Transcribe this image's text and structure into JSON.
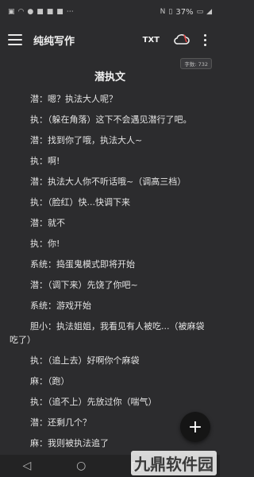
{
  "status_bar": {
    "battery_text": "37%",
    "left_icons": [
      "sim-icon",
      "wifi-icon",
      "app-icon",
      "app-icon",
      "app-icon",
      "app-icon",
      "more-icon"
    ],
    "right_icons": [
      "nfc-icon",
      "vibrate-icon",
      "battery-icon",
      "signal-icon"
    ]
  },
  "app_bar": {
    "title": "纯纯写作",
    "txt_label": "TXT"
  },
  "word_count": "字数: 732",
  "document": {
    "title": "潜执文",
    "paragraphs": [
      "潜：嗯？执法大人呢？",
      "执：（躲在角落）这下不会遇见潜行了吧。",
      "潜：找到你了哦，执法大人~",
      "执：啊!",
      "潜：执法大人你不听话哦~（调高三档）",
      "执：（脸红）快...快调下来",
      "潜：就不",
      "执：你!",
      "系统：捣蛋鬼模式即将开始",
      "潜：（调下来）先饶了你吧~",
      "系统：游戏开始",
      "胆小：执法姐姐，我看见有人被吃...（被麻袋吃了）",
      "执：（追上去）好啊你个麻袋",
      "麻：（跑）",
      "执：（追不上）先放过你（喘气）",
      "潜：还剩几个？",
      "麻：我则被执法追了"
    ]
  },
  "fab_label": "+",
  "nav": {
    "back": "◁",
    "home": "○",
    "recent": "□"
  },
  "watermark": "九鼎软件园",
  "colors": {
    "background": "#2c2c2e",
    "text": "#e4e4e4",
    "fab": "#151515"
  }
}
